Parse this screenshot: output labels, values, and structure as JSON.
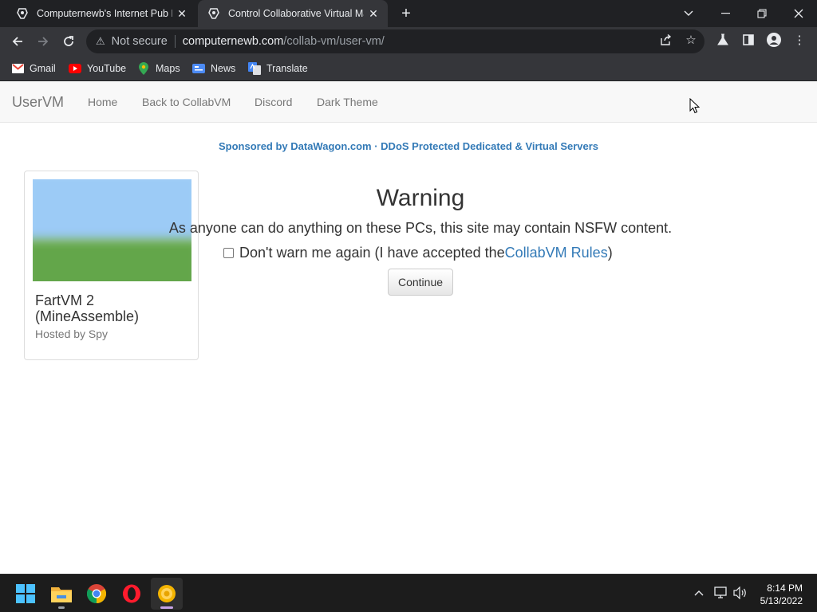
{
  "browser": {
    "tabs": [
      {
        "title": "Computernewb's Internet Pub Hub",
        "active": false
      },
      {
        "title": "Control Collaborative Virtual Machines",
        "active": true
      }
    ],
    "omnibox": {
      "security_label": "Not secure",
      "host": "computernewb.com",
      "path": "/collab-vm/user-vm/"
    },
    "bookmarks": [
      "Gmail",
      "YouTube",
      "Maps",
      "News",
      "Translate"
    ]
  },
  "page": {
    "navbar": {
      "brand": "UserVM",
      "links": [
        "Home",
        "Back to CollabVM",
        "Discord",
        "Dark Theme"
      ]
    },
    "sponsor": "Sponsored by DataWagon.com · DDoS Protected Dedicated & Virtual Servers",
    "vm_card": {
      "name": "FartVM 2 (MineAssemble)",
      "host": "Hosted by Spy"
    },
    "warning": {
      "title": "Warning",
      "text": "As anyone can do anything on these PCs, this site may contain NSFW content.",
      "accept_prefix": "Don't warn me again (I have accepted the ",
      "accept_link": "CollabVM Rules",
      "accept_suffix": ")",
      "continue_label": "Continue",
      "checkbox_checked": false
    }
  },
  "taskbar": {
    "clock_time": "8:14 PM",
    "clock_date": "5/13/2022"
  }
}
